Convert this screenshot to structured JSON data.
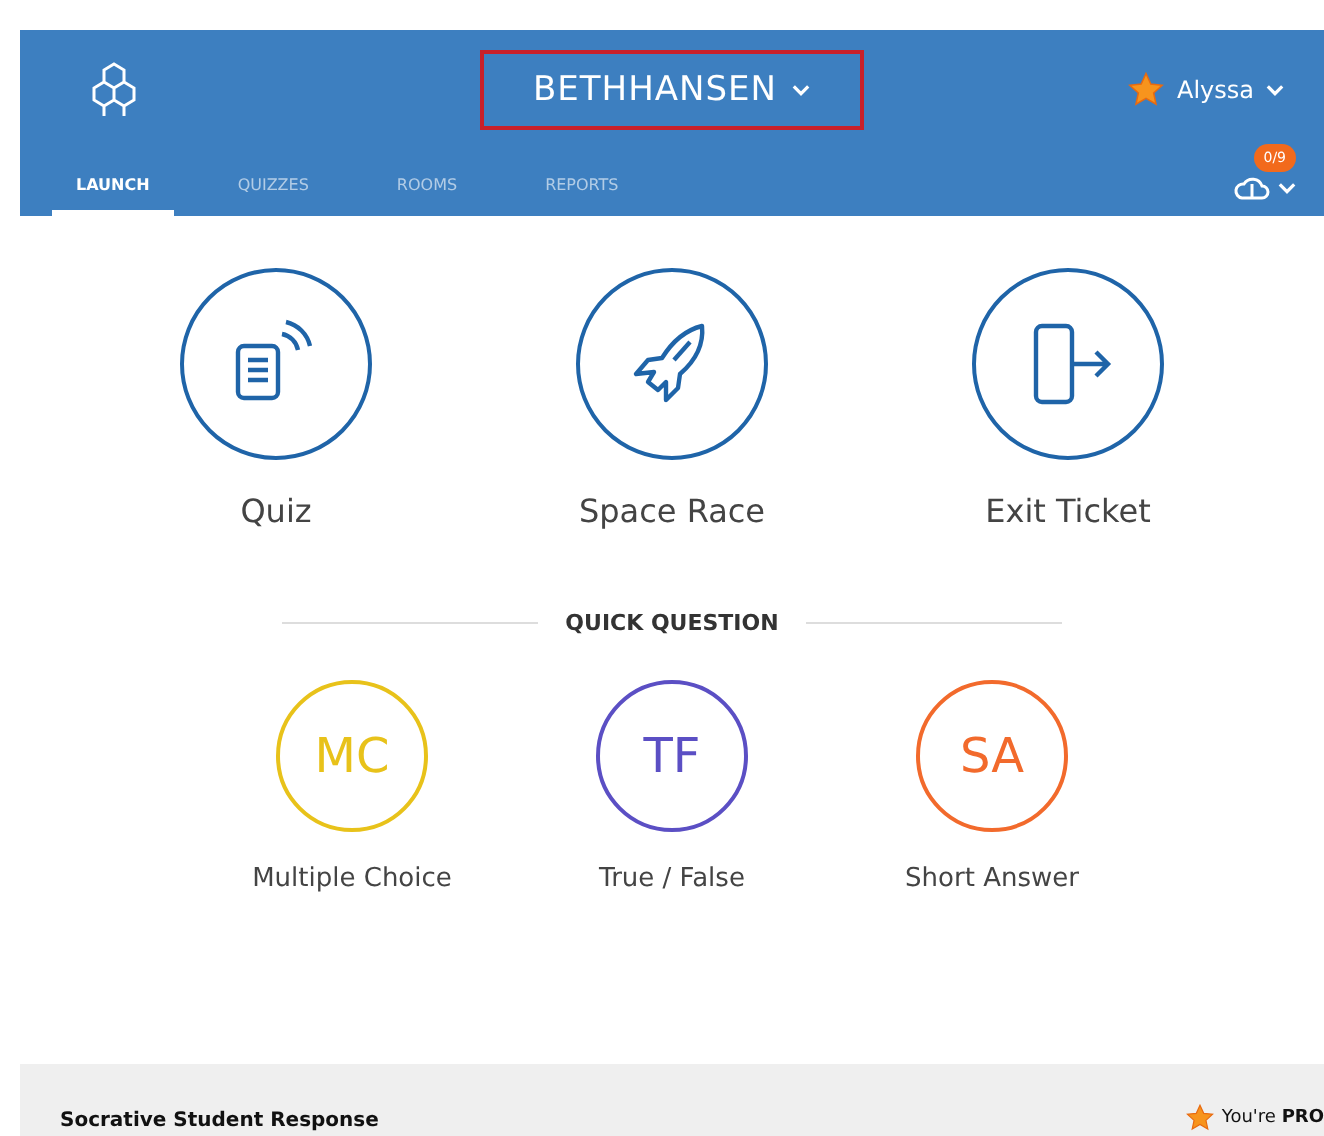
{
  "header": {
    "room_name": "BETHHANSEN",
    "user_name": "Alyssa",
    "badge": "0/9"
  },
  "tabs": [
    {
      "label": "LAUNCH",
      "selected": true
    },
    {
      "label": "QUIZZES",
      "selected": false
    },
    {
      "label": "ROOMS",
      "selected": false
    },
    {
      "label": "REPORTS",
      "selected": false
    }
  ],
  "activities": [
    {
      "kind": "quiz",
      "label": "Quiz"
    },
    {
      "kind": "rocket",
      "label": "Space Race"
    },
    {
      "kind": "exit",
      "label": "Exit Ticket"
    }
  ],
  "quick_question": {
    "title": "QUICK QUESTION",
    "options": [
      {
        "abbr": "MC",
        "label": "Multiple Choice",
        "color": "#e8c21a"
      },
      {
        "abbr": "TF",
        "label": "True / False",
        "color": "#5b4fc4"
      },
      {
        "abbr": "SA",
        "label": "Short Answer",
        "color": "#f26a2c"
      }
    ]
  },
  "footer": {
    "title": "Socrative Student Response",
    "pro_prefix": "You're",
    "pro_word": "PRO"
  }
}
